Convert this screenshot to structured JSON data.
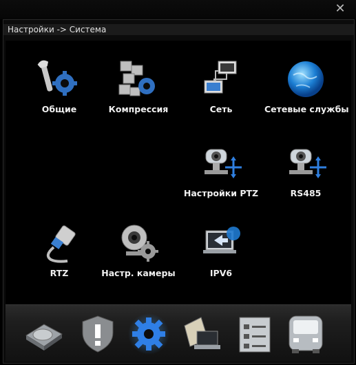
{
  "window": {
    "close_icon": "close-icon"
  },
  "breadcrumb": "Настройки -> Система",
  "tiles": [
    {
      "label": "Общие",
      "icon": "wrench-gear-icon"
    },
    {
      "label": "Компрессия",
      "icon": "compression-icon"
    },
    {
      "label": "Сеть",
      "icon": "network-icon"
    },
    {
      "label": "Сетевые службы",
      "icon": "globe-icon"
    },
    {
      "label": "Настройки PTZ",
      "icon": "ptz-camera-icon"
    },
    {
      "label": "RS485",
      "icon": "rs485-camera-icon"
    },
    {
      "label": "RTZ",
      "icon": "cable-plug-icon"
    },
    {
      "label": "Настр. камеры",
      "icon": "webcam-gear-icon"
    },
    {
      "label": "IPV6",
      "icon": "laptop-globe-icon"
    }
  ],
  "dock": [
    {
      "icon": "hdd-icon"
    },
    {
      "icon": "alarm-shield-icon"
    },
    {
      "icon": "system-gear-icon",
      "active": true
    },
    {
      "icon": "record-schedule-icon"
    },
    {
      "icon": "checklist-icon"
    },
    {
      "icon": "bus-icon"
    }
  ]
}
